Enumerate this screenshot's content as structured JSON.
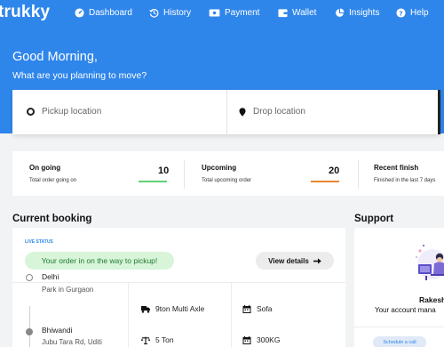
{
  "app": {
    "logo": "trukky"
  },
  "nav": [
    {
      "label": "Dashboard",
      "icon": "dashboard-gauge-icon"
    },
    {
      "label": "History",
      "icon": "history-clock-icon"
    },
    {
      "label": "Payment",
      "icon": "payment-card-icon"
    },
    {
      "label": "Wallet",
      "icon": "wallet-icon"
    },
    {
      "label": "Insights",
      "icon": "insights-pie-icon"
    },
    {
      "label": "Help",
      "icon": "help-question-icon"
    }
  ],
  "hero": {
    "greeting": "Good Morning,",
    "subtitle": "What are you planning to move?"
  },
  "location": {
    "pickup_placeholder": "Pickup location",
    "drop_placeholder": "Drop location"
  },
  "stats": [
    {
      "title": "On going",
      "sub": "Total order going on",
      "value": "10",
      "bar_color": "#5fd07a"
    },
    {
      "title": "Upcoming",
      "sub": "Total upcoming order",
      "value": "20",
      "bar_color": "#e8862f"
    },
    {
      "title": "Recent finish",
      "sub": "Finished in the last 7 days"
    }
  ],
  "current_booking": {
    "heading": "Current booking",
    "live_status_label": "LIVE STATUS",
    "status_text": "Your order in on the way to pickup!",
    "details_label": "View details",
    "from_city": "Delhi",
    "from_area": "Park in Gurgaon",
    "to_city": "Bhiwandi",
    "to_area": "Jubu Tara Rd, Uditi",
    "truck": "9ton Multi Axle",
    "capacity": "5 Ton",
    "goods": "Sofa",
    "weight": "300KG"
  },
  "support": {
    "heading": "Support",
    "name": "Rakesh",
    "role": "Your account mana",
    "button": "Schedule a call"
  },
  "colors": {
    "brand_blue": "#2f86ea",
    "status_green_bg": "#d8f5da",
    "status_green_text": "#1f7a2e"
  }
}
